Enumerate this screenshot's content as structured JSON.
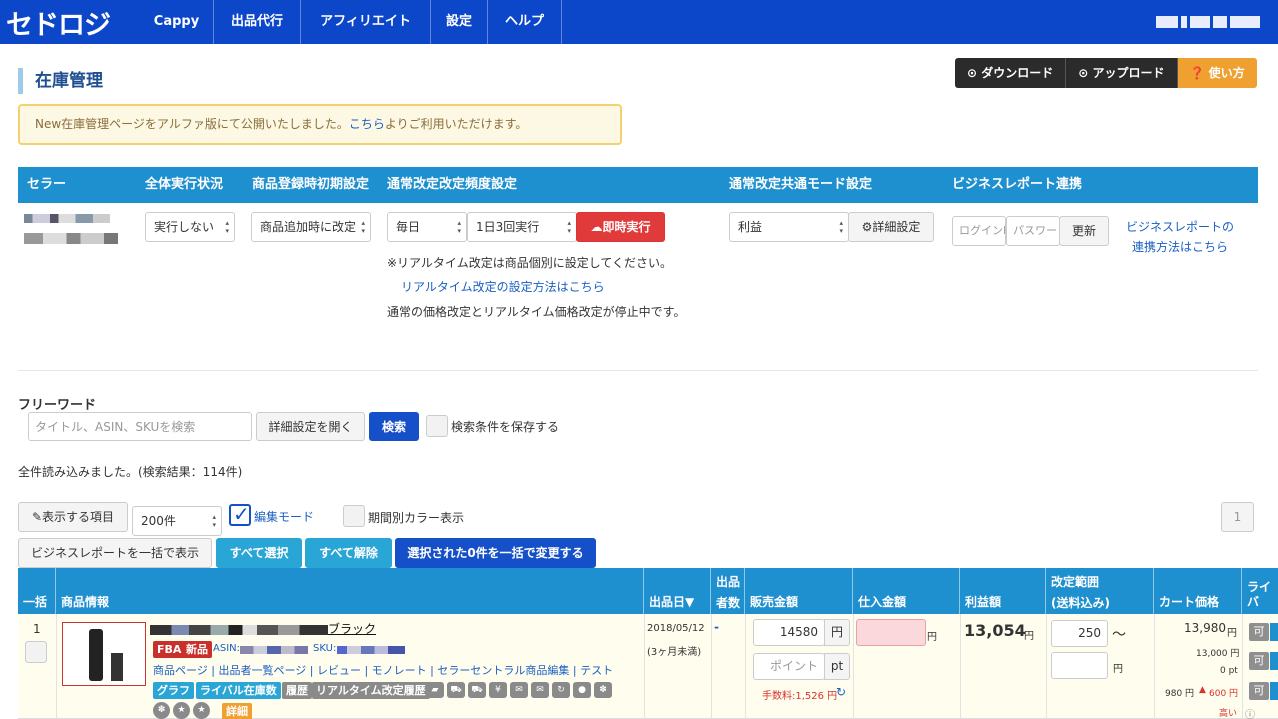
{
  "nav": {
    "logo": "セドロジ",
    "items": [
      "Cappy",
      "出品代行",
      "アフィリエイト",
      "設定",
      "ヘルプ"
    ]
  },
  "page": {
    "title": "在庫管理"
  },
  "top_buttons": {
    "download": "ダウンロード",
    "upload": "アップロード",
    "howto": "使い方"
  },
  "notice": {
    "before": "New在庫管理ページをアルファ版にて公開いたしました。",
    "link": "こちら",
    "after": "よりご利用いただけます。"
  },
  "settings": {
    "headers": {
      "seller": "セラー",
      "run_status": "全体実行状況",
      "initial": "商品登録時初期設定",
      "freq": "通常改定改定頻度設定",
      "mode": "通常改定共通モード設定",
      "bizreport": "ビジネスレポート連携"
    },
    "run_status": "実行しない",
    "initial": "商品追加時に改定",
    "freq_daily": "毎日",
    "freq_times": "1日3回実行",
    "run_now": "即時実行",
    "mode": "利益",
    "mode_detail": "詳細設定",
    "login_placeholder": "ログインID",
    "password_placeholder": "パスワード",
    "update": "更新",
    "biz_link_1": "ビジネスレポートの",
    "biz_link_2": "連携方法はこちら",
    "realtime_note": "※リアルタイム改定は商品個別に設定してください。",
    "realtime_link": "リアルタイム改定の設定方法はこちら",
    "stopped_note": "通常の価格改定とリアルタイム価格改定が停止中です。"
  },
  "search": {
    "label": "フリーワード",
    "placeholder": "タイトル、ASIN、SKUを検索",
    "detail_btn": "詳細設定を開く",
    "search_btn": "検索",
    "save_label": "検索条件を保存する",
    "result": "全件読み込みました。(検索結果：114件)"
  },
  "toolbar": {
    "display_items": "表示する項目",
    "per_page": "200件",
    "edit_mode": "編集モード",
    "period_color": "期間別カラー表示",
    "page_number": "1",
    "bulk_report": "ビジネスレポートを一括で表示",
    "select_all": "すべて選択",
    "deselect_all": "すべて解除",
    "bulk_change": "選択された0件を一括で変更する"
  },
  "table": {
    "headers": {
      "bulk": "一括",
      "product": "商品情報",
      "listed": "出品日▼",
      "sellers_1": "出品",
      "sellers_2": "者数",
      "price": "販売金額",
      "cost": "仕入金額",
      "profit": "利益額",
      "range_1": "改定範囲",
      "range_2": "(送料込み)",
      "cart": "カート価格",
      "rival": "ライバ"
    },
    "row": {
      "index": "1",
      "title_suffix": "ブラック",
      "tag_fba": "FBA",
      "tag_new": "新品",
      "asin_label": "ASIN:",
      "sku_label": "SKU:",
      "links": [
        "商品ページ",
        "出品者一覧ページ",
        "レビュー",
        "モノレート",
        "セラーセントラル商品編集",
        "テスト"
      ],
      "btn_graph": "グラフ",
      "btn_rival": "ライバル在庫数",
      "btn_history": "履歴",
      "btn_rt_history": "リアルタイム改定履歴",
      "btn_detail": "詳細",
      "listed_date": "2018/05/12",
      "listed_age": "(3ヶ月未満)",
      "sellers": "-",
      "price": "14580",
      "yen": "円",
      "point_placeholder": "ポイント",
      "pt": "pt",
      "fee": "手数料:1,526 円",
      "profit": "13,054",
      "range_min": "250",
      "tilde": "〜",
      "cart_price": "13,980",
      "cart_sub1": "13,000 円",
      "cart_sub2": "0 pt",
      "cart_sub3": "980 円",
      "cart_diff": "600 円",
      "cart_note": "高い",
      "ka": "可"
    }
  }
}
